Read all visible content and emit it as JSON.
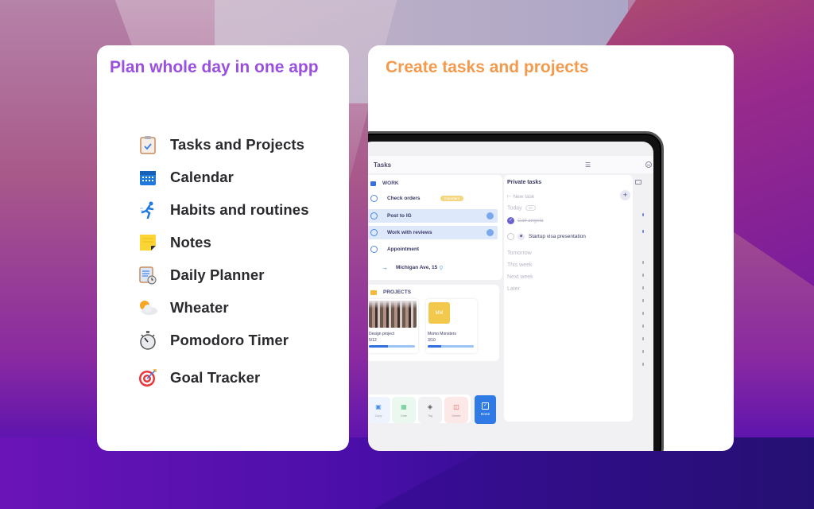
{
  "left_card": {
    "title": "Plan whole day in one app",
    "features": [
      {
        "icon": "clipboard-check-icon",
        "label": "Tasks and Projects"
      },
      {
        "icon": "calendar-icon",
        "label": "Calendar"
      },
      {
        "icon": "running-person-icon",
        "label": "Habits and routines"
      },
      {
        "icon": "sticky-note-icon",
        "label": "Notes"
      },
      {
        "icon": "clipboard-clock-icon",
        "label": "Daily Planner"
      },
      {
        "icon": "sun-behind-cloud-icon",
        "label": "Wheater"
      },
      {
        "icon": "stopwatch-icon",
        "label": "Pomodoro Timer"
      },
      {
        "icon": "target-icon",
        "label": "Goal Tracker"
      }
    ]
  },
  "right_card": {
    "title": "Create tasks and projects",
    "app": {
      "header": {
        "title": "Tasks"
      },
      "work": {
        "heading": "WORK",
        "tasks": [
          {
            "label": "Check orders",
            "badge": "Important",
            "selected": false
          },
          {
            "label": "Post to IG",
            "selected": true
          },
          {
            "label": "Work with reviews",
            "selected": true
          },
          {
            "label": "Appointment",
            "selected": false
          }
        ],
        "subtask": {
          "label": "Michigan Ave, 15"
        }
      },
      "projects": {
        "heading": "PROJECTS",
        "items": [
          {
            "name": "Design project",
            "count": "5/12",
            "progress": 0.42
          },
          {
            "name": "Momo Monsters",
            "initials": "MM",
            "count": "3/10",
            "progress": 0.3
          }
        ]
      },
      "actions": [
        {
          "id": "copy",
          "label": "Copy",
          "icon": "wallet-icon"
        },
        {
          "id": "date",
          "label": "Date",
          "icon": "calendar-icon"
        },
        {
          "id": "tag",
          "label": "Tag",
          "icon": "tag-icon"
        },
        {
          "id": "delete",
          "label": "Delete",
          "icon": "trash-icon"
        }
      ],
      "done_button": {
        "label": "Done"
      },
      "private": {
        "title": "Private tasks",
        "new_task_placeholder": "New task",
        "today": {
          "label": "Today",
          "count": "10"
        },
        "completed_task": "Call angela",
        "open_task": "Startup visa presentation",
        "sections": [
          "Tomorrow",
          "This week",
          "Next week",
          "Later"
        ]
      }
    }
  },
  "colors": {
    "left_title": "#9a4fe0",
    "right_title": "#f39a4c",
    "accent_blue": "#2f7ae5"
  }
}
